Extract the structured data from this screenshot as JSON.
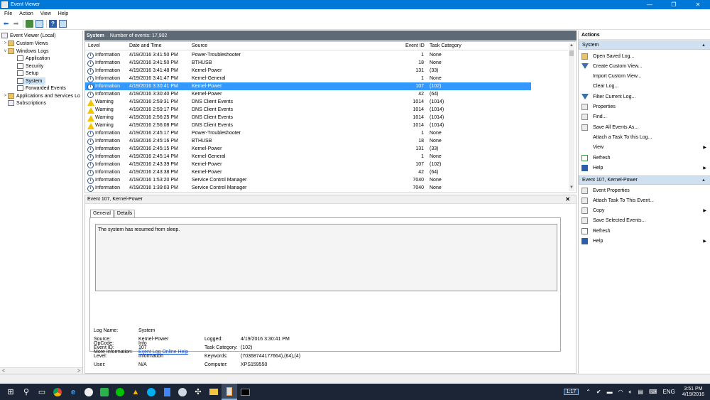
{
  "window": {
    "title": "Event Viewer",
    "controls": [
      "—",
      "❐",
      "✕"
    ]
  },
  "menu": [
    "File",
    "Action",
    "View",
    "Help"
  ],
  "tree": {
    "root": "Event Viewer (Local)",
    "items": [
      {
        "label": "Custom Views",
        "expander": ">"
      },
      {
        "label": "Windows Logs",
        "expander": "v"
      },
      {
        "label": "Application"
      },
      {
        "label": "Security"
      },
      {
        "label": "Setup"
      },
      {
        "label": "System"
      },
      {
        "label": "Forwarded Events"
      },
      {
        "label": "Applications and Services Lo",
        "expander": ">"
      },
      {
        "label": "Subscriptions"
      }
    ],
    "scroll_left": "<",
    "scroll_right": ">"
  },
  "log_header": {
    "name": "System",
    "count": "Number of events: 17,902"
  },
  "columns": [
    "Level",
    "Date and Time",
    "Source",
    "Event ID",
    "Task Category"
  ],
  "events": [
    {
      "level": "Information",
      "date": "4/19/2016 3:41:50 PM",
      "source": "Power-Troubleshooter",
      "id": "1",
      "task": "None"
    },
    {
      "level": "Information",
      "date": "4/19/2016 3:41:50 PM",
      "source": "BTHUSB",
      "id": "18",
      "task": "None"
    },
    {
      "level": "Information",
      "date": "4/19/2016 3:41:48 PM",
      "source": "Kernel-Power",
      "id": "131",
      "task": "(33)"
    },
    {
      "level": "Information",
      "date": "4/19/2016 3:41:47 PM",
      "source": "Kernel-General",
      "id": "1",
      "task": "None"
    },
    {
      "level": "Information",
      "date": "4/19/2016 3:30:41 PM",
      "source": "Kernel-Power",
      "id": "107",
      "task": "(102)"
    },
    {
      "level": "Information",
      "date": "4/19/2016 3:30:40 PM",
      "source": "Kernel-Power",
      "id": "42",
      "task": "(64)"
    },
    {
      "level": "Warning",
      "date": "4/19/2016 2:59:31 PM",
      "source": "DNS Client Events",
      "id": "1014",
      "task": "(1014)"
    },
    {
      "level": "Warning",
      "date": "4/19/2016 2:59:17 PM",
      "source": "DNS Client Events",
      "id": "1014",
      "task": "(1014)"
    },
    {
      "level": "Warning",
      "date": "4/19/2016 2:56:25 PM",
      "source": "DNS Client Events",
      "id": "1014",
      "task": "(1014)"
    },
    {
      "level": "Warning",
      "date": "4/19/2016 2:56:08 PM",
      "source": "DNS Client Events",
      "id": "1014",
      "task": "(1014)"
    },
    {
      "level": "Information",
      "date": "4/19/2016 2:45:17 PM",
      "source": "Power-Troubleshooter",
      "id": "1",
      "task": "None"
    },
    {
      "level": "Information",
      "date": "4/19/2016 2:45:16 PM",
      "source": "BTHUSB",
      "id": "18",
      "task": "None"
    },
    {
      "level": "Information",
      "date": "4/19/2016 2:45:15 PM",
      "source": "Kernel-Power",
      "id": "131",
      "task": "(33)"
    },
    {
      "level": "Information",
      "date": "4/19/2016 2:45:14 PM",
      "source": "Kernel-General",
      "id": "1",
      "task": "None"
    },
    {
      "level": "Information",
      "date": "4/19/2016 2:43:39 PM",
      "source": "Kernel-Power",
      "id": "107",
      "task": "(102)"
    },
    {
      "level": "Information",
      "date": "4/19/2016 2:43:38 PM",
      "source": "Kernel-Power",
      "id": "42",
      "task": "(64)"
    },
    {
      "level": "Information",
      "date": "4/19/2016 1:53:20 PM",
      "source": "Service Control Manager",
      "id": "7040",
      "task": "None"
    },
    {
      "level": "Information",
      "date": "4/19/2016 1:39:03 PM",
      "source": "Service Control Manager",
      "id": "7040",
      "task": "None"
    }
  ],
  "selected_event_index": 4,
  "detail": {
    "title": "Event 107, Kernel-Power",
    "close": "✕",
    "tabs": [
      "General",
      "Details"
    ],
    "message": "The system has resumed from sleep.",
    "fields": {
      "log_name_label": "Log Name:",
      "log_name": "System",
      "source_label": "Source:",
      "source": "Kernel-Power",
      "logged_label": "Logged:",
      "logged": "4/19/2016 3:30:41 PM",
      "event_id_label": "Event ID:",
      "event_id": "107",
      "task_label": "Task Category:",
      "task": "(102)",
      "level_label": "Level:",
      "level": "Information",
      "keywords_label": "Keywords:",
      "keywords": "(70368744177664),(64),(4)",
      "user_label": "User:",
      "user": "N/A",
      "computer_label": "Computer:",
      "computer": "XPS159550",
      "opcode_label": "OpCode:",
      "opcode": "Info",
      "more_info_label": "More Information:",
      "more_info_link": "Event Log Online Help"
    }
  },
  "actions": {
    "header": "Actions",
    "section1": "System",
    "section1_items": [
      {
        "label": "Open Saved Log...",
        "icon": "folder-icon"
      },
      {
        "label": "Create Custom View...",
        "icon": "filter-icon"
      },
      {
        "label": "Import Custom View...",
        "icon": ""
      },
      {
        "label": "Clear Log...",
        "icon": ""
      },
      {
        "label": "Filter Current Log...",
        "icon": "filter-icon"
      },
      {
        "label": "Properties",
        "icon": "properties-icon"
      },
      {
        "label": "Find...",
        "icon": "find-icon"
      },
      {
        "label": "Save All Events As...",
        "icon": "save-icon"
      },
      {
        "label": "Attach a Task To this Log...",
        "icon": ""
      },
      {
        "label": "View",
        "icon": "",
        "submenu": "▶"
      },
      {
        "label": "Refresh",
        "icon": "refresh-icon"
      },
      {
        "label": "Help",
        "icon": "help-icon",
        "submenu": "▶"
      }
    ],
    "section2": "Event 107, Kernel-Power",
    "section2_items": [
      {
        "label": "Event Properties",
        "icon": "properties-icon"
      },
      {
        "label": "Attach Task To This Event...",
        "icon": "task-icon"
      },
      {
        "label": "Copy",
        "icon": "copy-icon",
        "submenu": "▶"
      },
      {
        "label": "Save Selected Events...",
        "icon": "save-icon"
      },
      {
        "label": "Refresh",
        "icon": "refresh-icon"
      },
      {
        "label": "Help",
        "icon": "help-icon",
        "submenu": "▶"
      }
    ]
  },
  "taskbar": {
    "badge": "1:17",
    "lang": "ENG",
    "time": "3:51 PM",
    "date": "4/19/2016"
  },
  "colors": {
    "title_bar": "#0078d7",
    "selected_row": "#3399ff",
    "log_header": "#5e6a76",
    "actions_section": "#cfe0f1",
    "taskbar": "#1b2535"
  }
}
